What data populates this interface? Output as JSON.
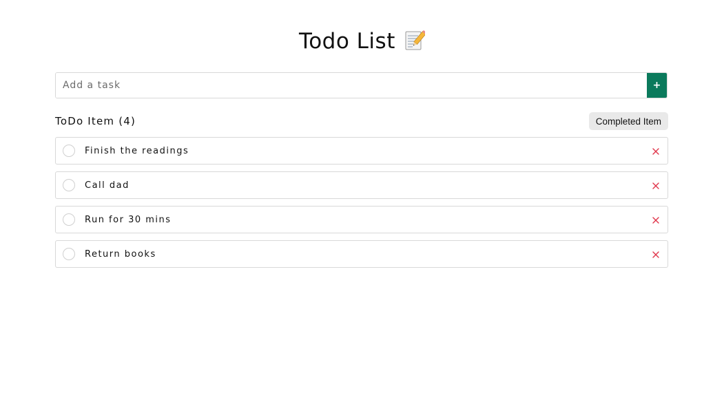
{
  "header": {
    "title": "Todo List",
    "title_icon": "memo-icon"
  },
  "add_task": {
    "placeholder": "Add a task",
    "value": "",
    "button_label": "+",
    "button_color": "#0b7a5c"
  },
  "section": {
    "title": "ToDo Item (4)",
    "completed_button_label": "Completed Item"
  },
  "todos": [
    {
      "text": "Finish the readings",
      "completed": false
    },
    {
      "text": "Call dad",
      "completed": false
    },
    {
      "text": "Run for 30 mins",
      "completed": false
    },
    {
      "text": "Return books",
      "completed": false
    }
  ],
  "colors": {
    "delete": "#e0344a",
    "border": "#d8d8d8"
  }
}
